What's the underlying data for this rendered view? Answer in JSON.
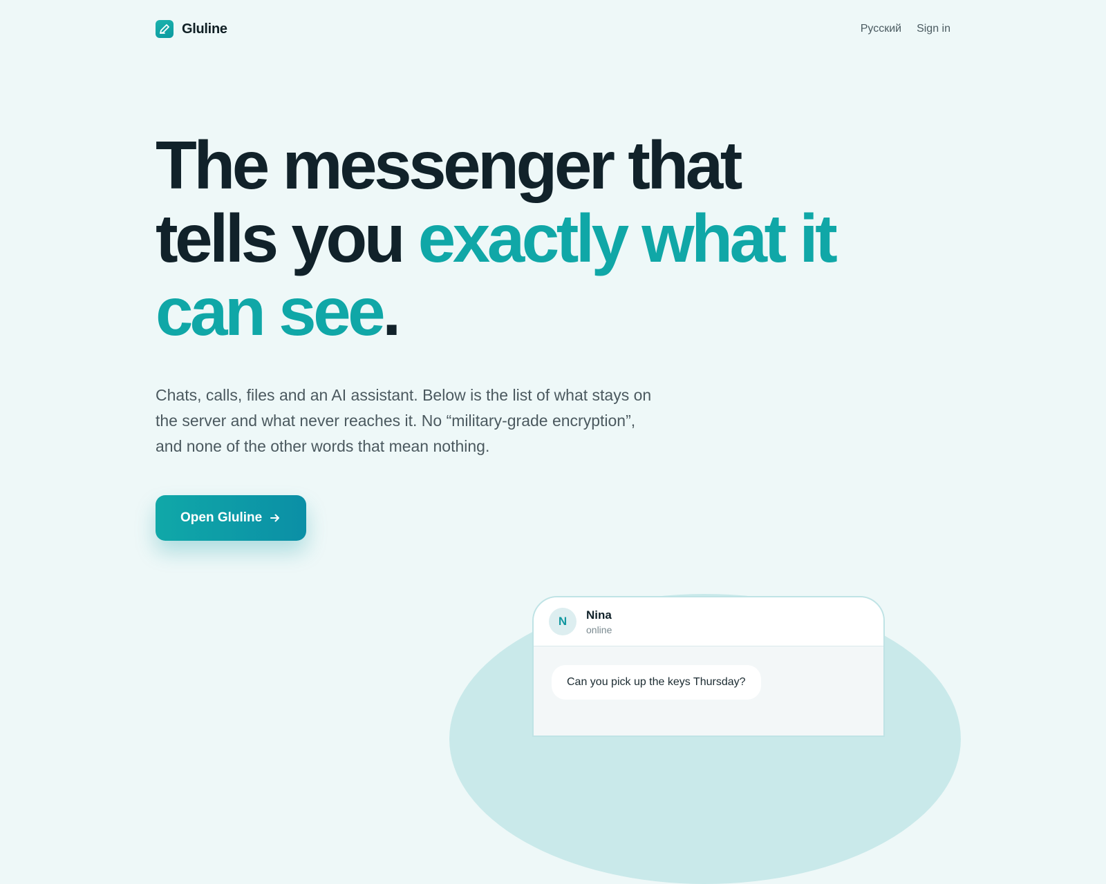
{
  "header": {
    "brand_name": "Gluline",
    "nav": {
      "language_label": "Русский",
      "signin_label": "Sign in"
    }
  },
  "hero": {
    "headline": {
      "part1": "The messenger that tells you ",
      "accent": "exactly what it can see",
      "end": "."
    },
    "lede": "Chats, calls, files and an AI assistant. Below is the list of what stays on the server and what never reaches it. No “military-grade encryption”, and none of the other words that mean nothing.",
    "cta_label": "Open Gluline"
  },
  "chat_preview": {
    "contact_initial": "N",
    "contact_name": "Nina",
    "contact_status": "online",
    "message": "Can you pick up the keys Thursday?"
  },
  "colors": {
    "background": "#eef8f8",
    "accent": "#10a7a7",
    "headline": "#11222a",
    "body_text": "#4b595f"
  },
  "icons": {
    "brand": "pen-icon",
    "cta": "arrow-right-icon"
  }
}
